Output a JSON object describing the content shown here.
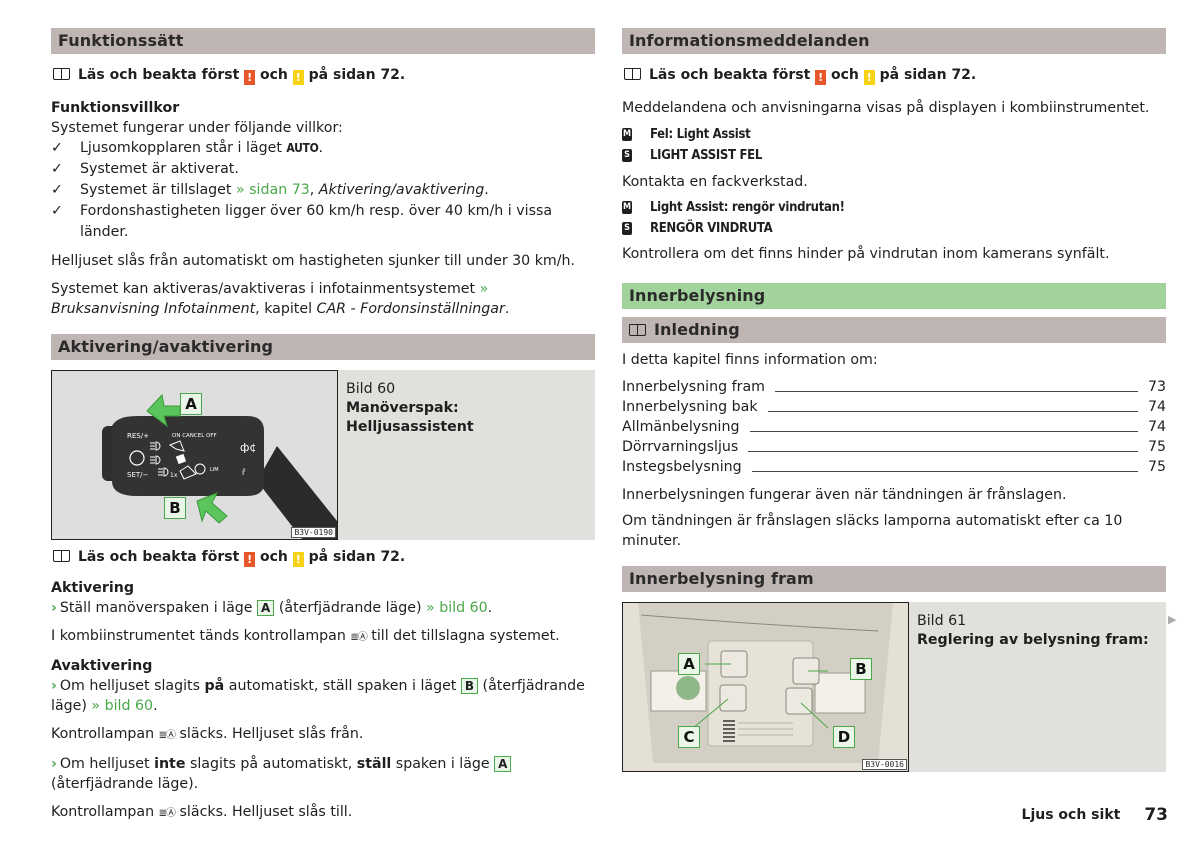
{
  "left": {
    "section1": {
      "title": "Funktionssätt",
      "note": {
        "prefix": "Läs och beakta först",
        "mid": "och",
        "suffix": "på sidan 72.",
        "warn_colors": [
          "#e8572a",
          "#f6d317"
        ]
      },
      "subhead": "Funktionsvillkor",
      "intro": "Systemet fungerar under följande villkor:",
      "conditions": [
        {
          "text": "Ljusomkopplaren står i läget ",
          "code": "AUTO",
          "after": "."
        },
        {
          "text": "Systemet är aktiverat."
        },
        {
          "text": "Systemet är tillslaget ",
          "link": "» sidan 73",
          "after_italic": "Aktivering/avaktivering",
          "after": "."
        },
        {
          "text": "Fordonshastigheten ligger över 60 km/h resp. över 40 km/h i vissa länder."
        }
      ],
      "para1": "Helljuset slås från automatiskt om hastigheten sjunker till under 30 km/h.",
      "para2": {
        "text": "Systemet kan aktiveras/avaktiveras i infotainmentsystemet ",
        "link": "»",
        "italic1": "Bruksanvisning Infotainment",
        "mid": ", kapitel ",
        "italic2": "CAR - Fordonsinställningar",
        "end": "."
      }
    },
    "section2": {
      "title": "Aktivering/avaktivering",
      "figure": {
        "number": "Bild 60",
        "caption": "Manöverspak: Helljusassistent",
        "code": "B3V-0190",
        "labels": [
          "A",
          "B"
        ],
        "lever_texts": [
          "RES/+",
          "ON CANCEL OFF",
          "SET/−",
          "1x",
          "LIM"
        ]
      },
      "note": {
        "prefix": "Läs och beakta först",
        "mid": "och",
        "suffix": "på sidan 72."
      },
      "activation": {
        "title": "Aktivering",
        "step": {
          "text": "Ställ manöverspaken i läge ",
          "key": "A",
          "after": " (återfjädrande läge) ",
          "link": "» bild 60",
          "end": "."
        },
        "result": {
          "before": "I kombiinstrumentet tänds kontrollampan ",
          "lamp": "≣Ⓐ",
          "after": " till det tillslagna systemet."
        }
      },
      "deactivation": {
        "title": "Avaktivering",
        "step1": {
          "before": "Om helljuset slagits ",
          "bold": "på",
          "after": " automatiskt, ställ spaken i läget ",
          "key": "B",
          "after2": " (återfjädrande läge) ",
          "link": "» bild 60",
          "end": "."
        },
        "result1": {
          "before": "Kontrollampan ",
          "lamp": "≣Ⓐ",
          "after": " släcks. Helljuset slås från."
        },
        "step2": {
          "before": "Om helljuset ",
          "bold": "inte",
          "after": " slagits på automatiskt, ",
          "bold2": "ställ",
          "after2": " spaken i läge ",
          "key": "A",
          "end": " (återfjädrande läge)."
        },
        "result2": {
          "before": "Kontrollampan ",
          "lamp": "≣Ⓐ",
          "after": " släcks. Helljuset slås till."
        }
      }
    }
  },
  "right": {
    "section1": {
      "title": "Informationsmeddelanden",
      "note": {
        "prefix": "Läs och beakta först",
        "mid": "och",
        "suffix": "på sidan 72."
      },
      "intro": "Meddelandena och anvisningarna visas på displayen i kombiinstrumentet.",
      "messages1": [
        {
          "badge": "M",
          "text": "Fel: Light Assist"
        },
        {
          "badge": "S",
          "text": "LIGHT ASSIST FEL"
        }
      ],
      "action1": "Kontakta en fackverkstad.",
      "messages2": [
        {
          "badge": "M",
          "text": "Light Assist: rengör vindrutan!"
        },
        {
          "badge": "S",
          "text": "RENGÖR VINDRUTA"
        }
      ],
      "action2": "Kontrollera om det finns hinder på vindrutan inom kamerans synfält."
    },
    "chapter": {
      "title": "Innerbelysning",
      "color": "#a3d39c"
    },
    "intro_section": {
      "title": "Inledning",
      "lead": "I detta kapitel finns information om:",
      "toc": [
        {
          "label": "Innerbelysning fram",
          "page": "73"
        },
        {
          "label": "Innerbelysning bak",
          "page": "74"
        },
        {
          "label": "Allmänbelysning",
          "page": "74"
        },
        {
          "label": "Dörrvarningsljus",
          "page": "75"
        },
        {
          "label": "Instegsbelysning",
          "page": "75"
        }
      ],
      "para1": "Innerbelysningen fungerar även när tändningen är frånslagen.",
      "para2": "Om tändningen är frånslagen släcks lamporna automatiskt efter ca 10 minuter."
    },
    "section3": {
      "title": "Innerbelysning fram",
      "figure": {
        "number": "Bild 61",
        "caption": "Reglering av belysning fram:",
        "code": "B3V-0016",
        "labels": [
          "A",
          "B",
          "C",
          "D"
        ]
      }
    }
  },
  "footer": {
    "chapter": "Ljus och sikt",
    "page": "73"
  }
}
